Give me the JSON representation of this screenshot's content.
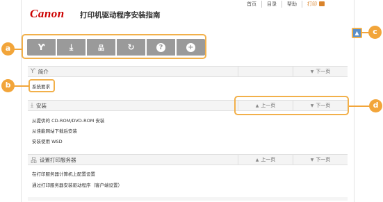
{
  "header": {
    "logo": "Canon",
    "title": "打印机驱动程序安装指南"
  },
  "topnav": [
    {
      "label": "首页"
    },
    {
      "label": "目录"
    },
    {
      "label": "帮助"
    },
    {
      "label": "打印"
    }
  ],
  "toolbar": {
    "buttons": [
      {
        "icon": "sprout-icon",
        "glyph": "Ƴ"
      },
      {
        "icon": "download-icon",
        "glyph": "⤓"
      },
      {
        "icon": "network-icon",
        "glyph": "品"
      },
      {
        "icon": "refresh-icon",
        "glyph": "↻"
      },
      {
        "icon": "help-icon",
        "glyph": "?"
      },
      {
        "icon": "plus-icon",
        "glyph": "+"
      }
    ]
  },
  "callouts": {
    "a": "a",
    "b": "b",
    "c": "c",
    "d": "d"
  },
  "sections": [
    {
      "title": "简介",
      "icon": "sprout-icon",
      "prev": "",
      "next": "下一页",
      "links": [
        "系统要求"
      ]
    },
    {
      "title": "安装",
      "icon": "download-icon",
      "prev": "上一页",
      "next": "下一页",
      "links": [
        "从提供的 CD-ROM/DVD-ROM 安装",
        "从佳能网站下载后安装",
        "安装使用 WSD"
      ]
    },
    {
      "title": "设置打印服务器",
      "icon": "network-icon",
      "prev": "上一页",
      "next": "下一页",
      "links": [
        "在打印服务器计算机上配置设置",
        "通过打印服务器安装驱动程序（客户端设置）"
      ]
    }
  ],
  "colors": {
    "accent": "#f2a53a",
    "brand": "#cc0000",
    "toolbar": "#9a9a9a"
  }
}
